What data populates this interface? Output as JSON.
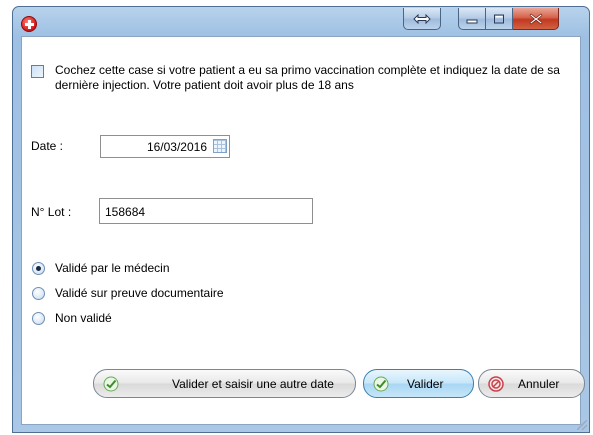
{
  "form": {
    "checkbox_text": "Cochez cette case si votre patient a eu sa primo vaccination complète et indiquez la date de sa dernière injection. Votre patient doit avoir plus de 18 ans",
    "checkbox_checked": false,
    "date_label": "Date :",
    "date_value": "16/03/2016",
    "lot_label": "N° Lot :",
    "lot_value": "158684",
    "radios": [
      {
        "label": "Validé par le médecin",
        "selected": true
      },
      {
        "label": "Validé sur preuve documentaire",
        "selected": false
      },
      {
        "label": "Non validé",
        "selected": false
      }
    ]
  },
  "buttons": {
    "next_label": "Valider et saisir une autre date",
    "ok_label": "Valider",
    "cancel_label": "Annuler"
  },
  "colors": {
    "frame": "#a9c7e6",
    "close_button": "#c2381f",
    "accent_button": "#a9d6f4"
  },
  "icons": [
    "app-logo-icon",
    "resize-icon",
    "minimize-icon",
    "maximize-icon",
    "close-icon",
    "calendar-icon",
    "check-icon",
    "cancel-icon"
  ]
}
